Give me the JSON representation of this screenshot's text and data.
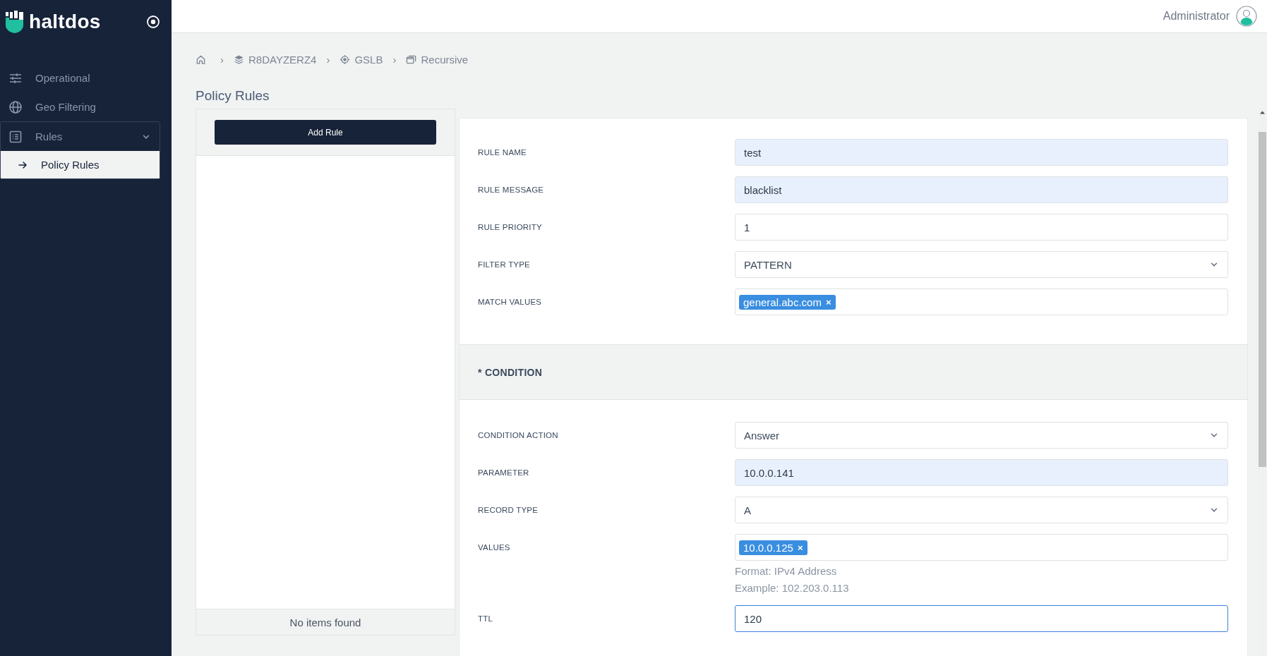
{
  "brand": {
    "name": "haltdos"
  },
  "header": {
    "user": "Administrator"
  },
  "sidebar": {
    "items": [
      {
        "label": "Operational",
        "kind": "sliders",
        "selected": false,
        "expanded": false
      },
      {
        "label": "Geo Filtering",
        "kind": "globe",
        "selected": false,
        "expanded": false
      },
      {
        "label": "Rules",
        "kind": "list",
        "selected": false,
        "expanded": true,
        "children": [
          {
            "label": "Policy Rules",
            "selected": true
          }
        ]
      }
    ]
  },
  "breadcrumb": {
    "separator": "›",
    "items": [
      {
        "kind": "home"
      },
      {
        "kind": "layers",
        "label": "R8DAYZERZ4"
      },
      {
        "kind": "crosshair",
        "label": "GSLB"
      },
      {
        "kind": "windows",
        "label": "Recursive"
      }
    ]
  },
  "page_title": "Policy Rules",
  "rule_list": {
    "add_button": "Add Rule",
    "empty_text": "No items found"
  },
  "rule_form": {
    "fields": [
      {
        "label": "RULE NAME",
        "kind": "text",
        "value": "test",
        "autofilled": true,
        "focused": false
      },
      {
        "label": "RULE MESSAGE",
        "kind": "text",
        "value": "blacklist",
        "autofilled": true,
        "focused": false
      },
      {
        "label": "RULE PRIORITY",
        "kind": "text",
        "value": "1",
        "autofilled": false,
        "focused": false
      },
      {
        "label": "FILTER TYPE",
        "kind": "select",
        "value": "PATTERN"
      },
      {
        "label": "MATCH VALUES",
        "kind": "tags",
        "tags": [
          "general.abc.com"
        ],
        "remove": "×"
      }
    ]
  },
  "condition": {
    "title": "* CONDITION",
    "fields": [
      {
        "label": "CONDITION ACTION",
        "kind": "select",
        "value": "Answer"
      },
      {
        "label": "PARAMETER",
        "kind": "text",
        "value": "10.0.0.141",
        "autofilled": true,
        "focused": false
      },
      {
        "label": "RECORD TYPE",
        "kind": "select",
        "value": "A"
      },
      {
        "label": "VALUES",
        "kind": "tags",
        "tags": [
          "10.0.0.125"
        ],
        "remove": "×",
        "help": [
          "Format: IPv4 Address",
          "Example: 102.203.0.113"
        ]
      },
      {
        "label": "TTL",
        "kind": "text",
        "value": "120",
        "autofilled": false,
        "focused": true
      }
    ]
  }
}
